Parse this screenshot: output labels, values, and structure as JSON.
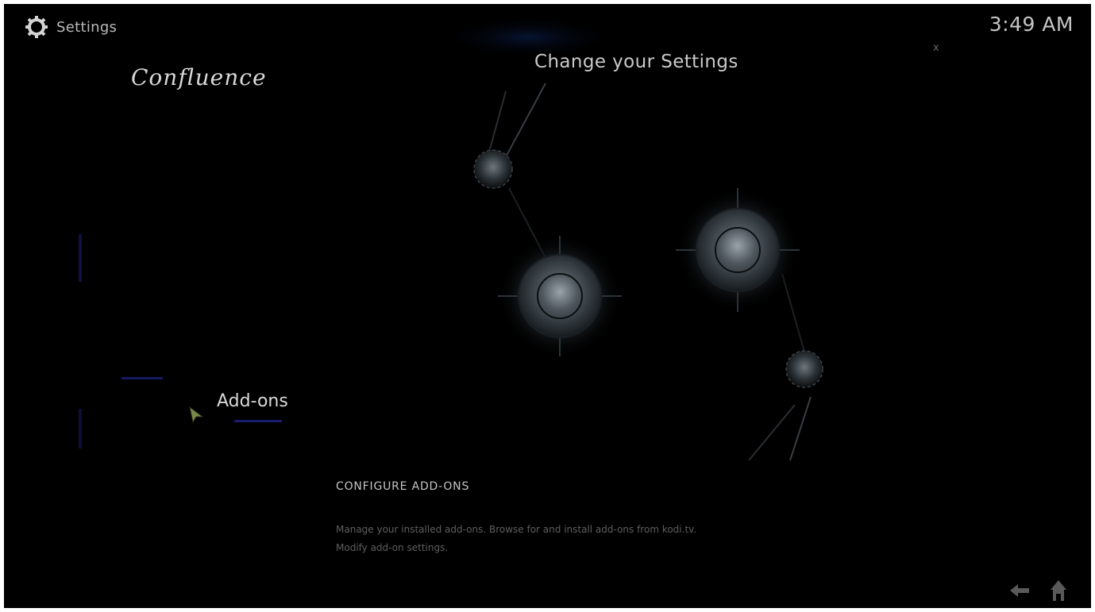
{
  "header": {
    "section_title": "Settings",
    "clock": "3:49 AM",
    "close_label": "x",
    "icon": "gear-icon"
  },
  "branding": {
    "logo_text": "Confluence"
  },
  "main": {
    "page_title": "Change your Settings",
    "selected_item": "Add-ons"
  },
  "description": {
    "title": "CONFIGURE ADD-ONS",
    "line1": "Manage your installed add-ons. Browse for and install add-ons from kodi.tv.",
    "line2": "Modify add-on settings."
  },
  "footer": {
    "back_icon": "back-arrow-icon",
    "home_icon": "home-icon"
  },
  "colors": {
    "background": "#000000",
    "text_primary": "#d8d8d8",
    "text_dim": "#5f5f5f",
    "accent_blue": "#1b1f7a"
  }
}
